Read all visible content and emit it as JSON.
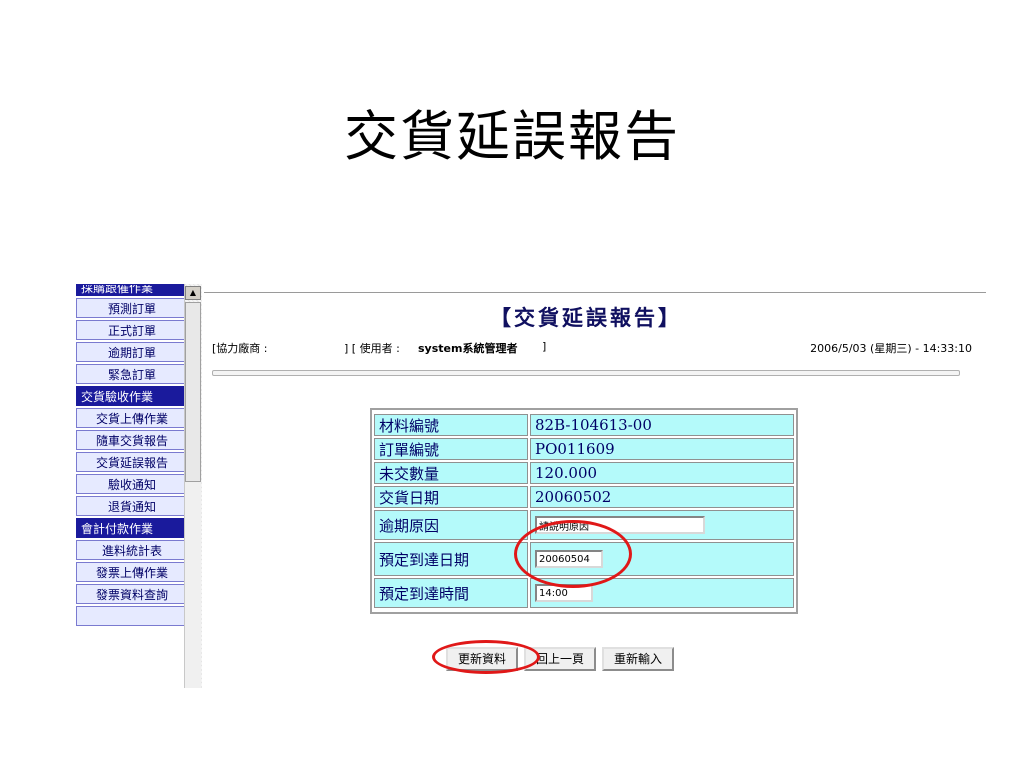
{
  "slide": {
    "title": "交貨延誤報告"
  },
  "sidebar": {
    "items": [
      {
        "label": "採購跟催作業",
        "type": "header-cut"
      },
      {
        "label": "預測訂單",
        "type": "item"
      },
      {
        "label": "正式訂單",
        "type": "item"
      },
      {
        "label": "逾期訂單",
        "type": "item"
      },
      {
        "label": "緊急訂單",
        "type": "item"
      },
      {
        "label": "交貨驗收作業",
        "type": "header"
      },
      {
        "label": "交貨上傳作業",
        "type": "item"
      },
      {
        "label": "隨車交貨報告",
        "type": "item"
      },
      {
        "label": "交貨延誤報告",
        "type": "item"
      },
      {
        "label": "驗收通知",
        "type": "item"
      },
      {
        "label": "退貨通知",
        "type": "item"
      },
      {
        "label": "會計付款作業",
        "type": "header"
      },
      {
        "label": "進料統計表",
        "type": "item"
      },
      {
        "label": "發票上傳作業",
        "type": "item"
      },
      {
        "label": "發票資料查詢",
        "type": "item"
      }
    ]
  },
  "panel": {
    "title": "【交貨延誤報告】",
    "vendor_label": "[協力廠商 :",
    "user_prefix": "] [ 使用者 :",
    "user_name": "system系統管理者",
    "user_suffix": "]",
    "datetime": "2006/5/03 (星期三) - 14:33:10"
  },
  "form": {
    "material_no": {
      "label": "材料編號",
      "value": "82B-104613-00"
    },
    "order_no": {
      "label": "訂單編號",
      "value": "PO011609"
    },
    "outstanding_qty": {
      "label": "未交數量",
      "value": "120.000"
    },
    "delivery_date": {
      "label": "交貨日期",
      "value": "20060502"
    },
    "overdue_reason": {
      "label": "逾期原因",
      "value": "請說明原因"
    },
    "expected_date": {
      "label": "預定到達日期",
      "value": "20060504"
    },
    "expected_time": {
      "label": "預定到達時間",
      "value": "14:00"
    }
  },
  "buttons": {
    "update": "更新資料",
    "back": "回上一頁",
    "reset": "重新輸入"
  },
  "colors": {
    "highlight": "#e01818",
    "field_bg": "#b4fafa",
    "sidebar_header": "#1a1a9c"
  }
}
